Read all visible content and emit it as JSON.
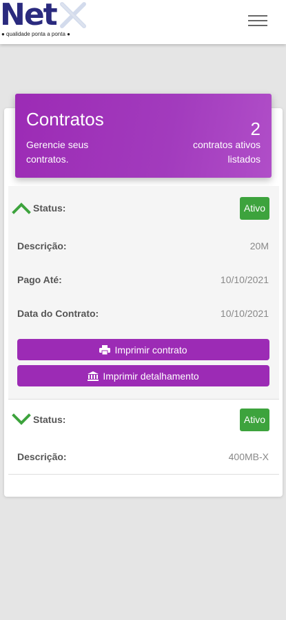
{
  "brand": {
    "name": "Net",
    "tagline": "● qualidade ponta a ponta ●"
  },
  "header": {
    "title": "Contratos",
    "description": "Gerencie seus contratos.",
    "count": "2",
    "count_label": "contratos ativos listados"
  },
  "contracts": [
    {
      "status_label": "Status:",
      "status": "Ativo",
      "description_label": "Descrição:",
      "description": "20M",
      "paid_until_label": "Pago Até:",
      "paid_until": "10/10/2021",
      "date_label": "Data do Contrato:",
      "date": "10/10/2021",
      "print_contract": "Imprimir contrato",
      "print_details": "Imprimir detalhamento",
      "expanded_icon": "chevron-up-icon"
    },
    {
      "status_label": "Status:",
      "status": "Ativo",
      "description_label": "Descrição:",
      "description": "400MB-X",
      "expanded_icon": "chevron-down-icon"
    }
  ],
  "colors": {
    "accent": "#9c2bb5",
    "success": "#3da33d",
    "brand": "#2a2a7e"
  }
}
